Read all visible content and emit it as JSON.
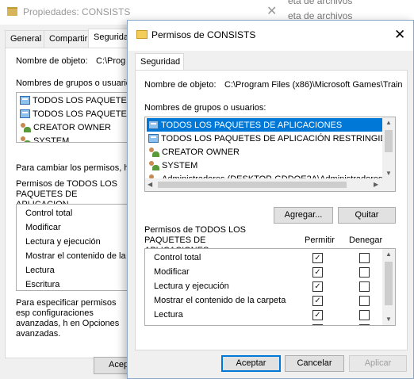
{
  "background_window": {
    "title": "Propiedades: CONSISTS",
    "close_glyph": "✕",
    "explorer_items": [
      "eta de archivos",
      "eta de archivos"
    ],
    "tabs": [
      "General",
      "Compartir",
      "Segurida"
    ],
    "object_label": "Nombre de objeto:",
    "object_value": "C:\\Prog",
    "groups_label": "Nombres de grupos o usuarios:",
    "users": [
      {
        "name": "TODOS LOS PAQUETE",
        "icon": "package-icon"
      },
      {
        "name": "TODOS LOS PAQUETE",
        "icon": "package-icon"
      },
      {
        "name": "CREATOR OWNER",
        "icon": "users-icon"
      },
      {
        "name": "SYSTEM",
        "icon": "users-icon"
      }
    ],
    "change_text": "Para cambiar los permisos, ha",
    "perm_heading": "Permisos de TODOS LOS PAQUETES DE APLICACION",
    "permissions": [
      "Control total",
      "Modificar",
      "Lectura y ejecución",
      "Mostrar el contenido de la c",
      "Lectura",
      "Escritura"
    ],
    "advanced_text": "Para especificar permisos esp configuraciones avanzadas, h en Opciones avanzadas.",
    "accept_label": "Acep"
  },
  "dialog": {
    "title": "Permisos de CONSISTS",
    "close_glyph": "✕",
    "tab_label": "Seguridad",
    "object_label": "Nombre de objeto:",
    "object_value": "C:\\Program Files (x86)\\Microsoft Games\\Train",
    "groups_label": "Nombres de grupos o usuarios:",
    "users": [
      {
        "name": "TODOS LOS PAQUETES DE APLICACIONES",
        "icon": "package-icon",
        "selected": true
      },
      {
        "name": "TODOS LOS PAQUETES DE APLICACIÓN RESTRINGID",
        "icon": "package-icon",
        "selected": false
      },
      {
        "name": "CREATOR OWNER",
        "icon": "users-icon",
        "selected": false
      },
      {
        "name": "SYSTEM",
        "icon": "users-icon",
        "selected": false
      },
      {
        "name": "Administradores (DESKTOP-GDDQE2A\\Administradores)",
        "icon": "users-icon",
        "selected": false
      }
    ],
    "add_label": "Agregar...",
    "remove_label": "Quitar",
    "perm_heading": "Permisos de TODOS LOS PAQUETES DE APLICACIONES",
    "col_allow": "Permitir",
    "col_deny": "Denegar",
    "permissions": [
      {
        "name": "Control total",
        "allow": true,
        "deny": false
      },
      {
        "name": "Modificar",
        "allow": true,
        "deny": false
      },
      {
        "name": "Lectura y ejecución",
        "allow": true,
        "deny": false
      },
      {
        "name": "Mostrar el contenido de la carpeta",
        "allow": true,
        "deny": false
      },
      {
        "name": "Lectura",
        "allow": true,
        "deny": false
      },
      {
        "name": "",
        "allow": true,
        "deny": false
      }
    ],
    "ok_label": "Aceptar",
    "cancel_label": "Cancelar",
    "apply_label": "Aplicar",
    "check_glyph": "✓"
  },
  "colors": {
    "selection": "#0078d7",
    "window_bg": "#f0f0f0",
    "default_button_border": "#0078d7"
  }
}
